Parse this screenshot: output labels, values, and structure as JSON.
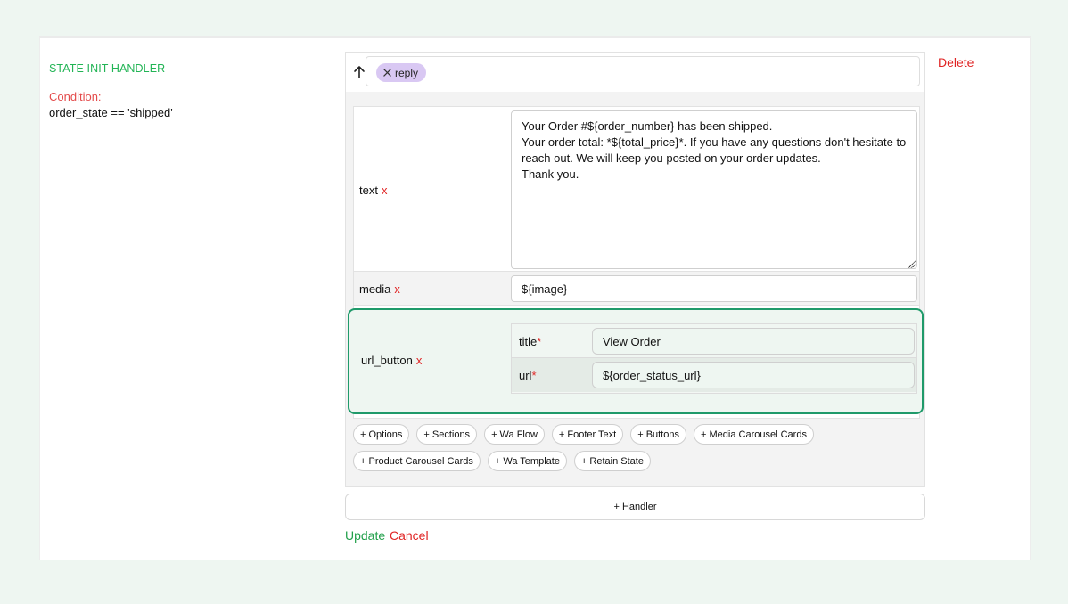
{
  "handler_panel": {
    "title": "STATE INIT HANDLER",
    "condition_label": "Condition:",
    "condition_value": "order_state == 'shipped'",
    "delete_label": "Delete"
  },
  "trigger": {
    "chip_label": "reply"
  },
  "fields": {
    "text": {
      "label": "text",
      "remove": "x",
      "lines": [
        "Your Order #${order_number} has been shipped.",
        "Your order total: *${total_price}*. If you have any questions don't hesitate to",
        "reach out. We will keep you posted on your order updates.",
        "Thank you."
      ]
    },
    "media": {
      "label": "media",
      "remove": "x",
      "value": "${image}"
    },
    "url_button": {
      "label": "url_button",
      "remove": "x",
      "title_label": "title",
      "title_value": "View Order",
      "url_label": "url",
      "url_value": "${order_status_url}",
      "required_mark": "*"
    }
  },
  "add_options": [
    "+ Options",
    "+ Sections",
    "+ Wa Flow",
    "+ Footer Text",
    "+ Buttons",
    "+ Media Carousel Cards",
    "+ Product Carousel Cards",
    "+ Wa Template",
    "+ Retain State"
  ],
  "actions": {
    "add_handler": "+ Handler",
    "update": "Update",
    "cancel": "Cancel"
  },
  "colors": {
    "accent_green": "#22b455",
    "danger_red": "#e02424",
    "focus_border": "#1f9a6a",
    "chip_purple": "#d9c8f3"
  }
}
